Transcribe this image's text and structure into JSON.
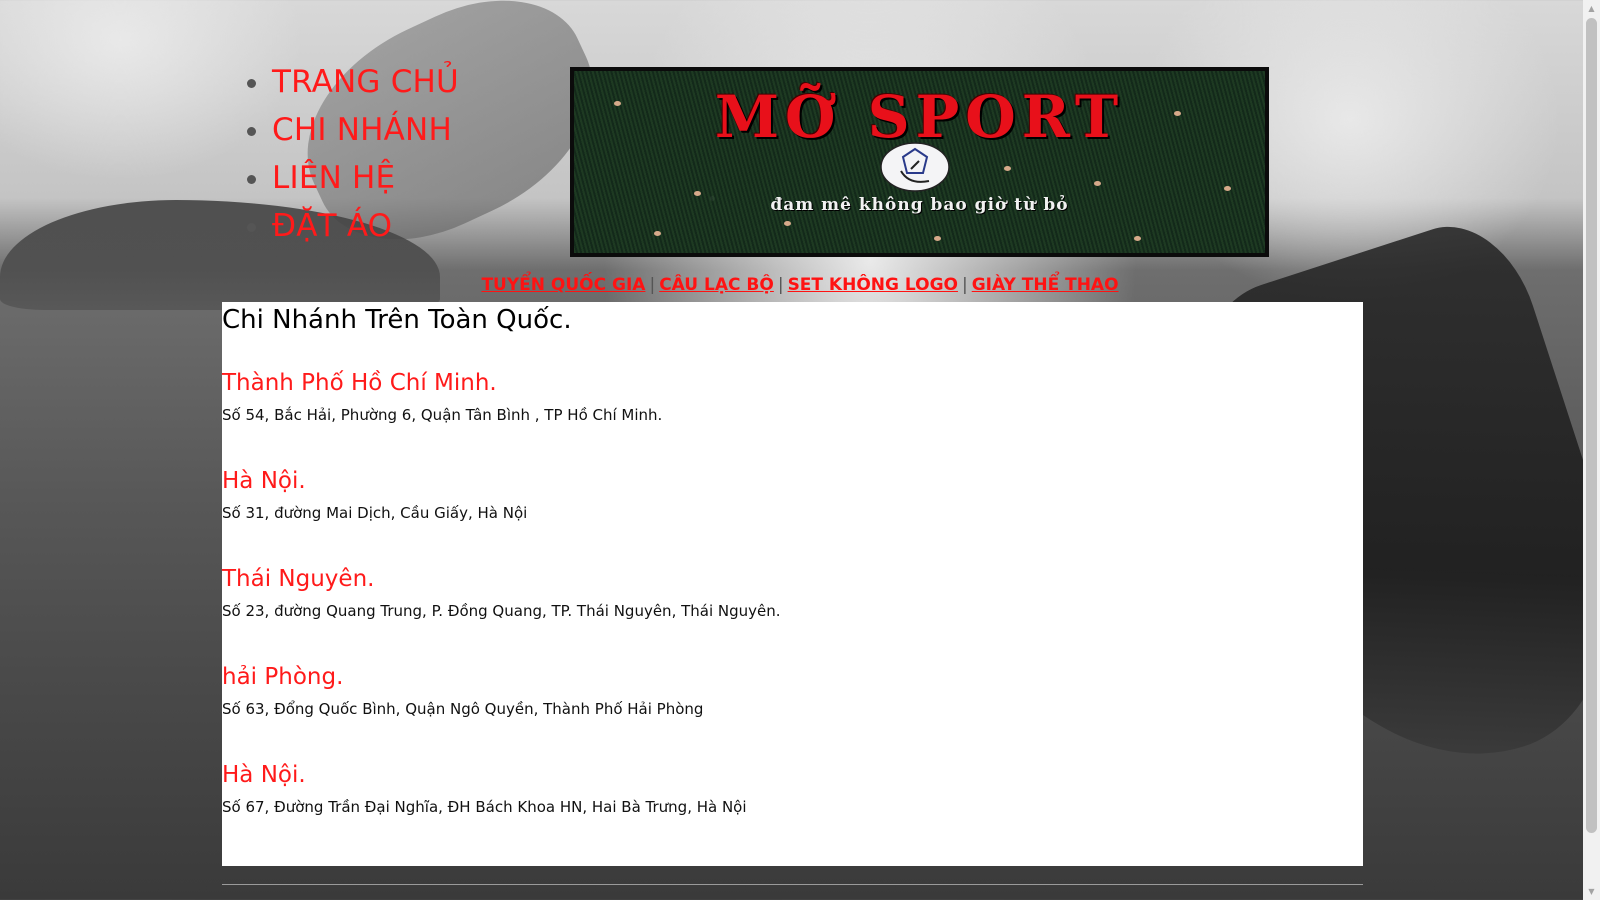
{
  "nav": {
    "items": [
      {
        "label": "TRANG CHỦ"
      },
      {
        "label": "CHI NHÁNH"
      },
      {
        "label": "LIÊN HỆ"
      },
      {
        "label": "ĐẶT ÁO"
      }
    ]
  },
  "logo": {
    "title": "MỠ SPORT",
    "tagline": "đam mê không bao giờ từ bỏ",
    "icon": "soccer-ball-icon"
  },
  "subnav": {
    "links": [
      {
        "label": "TUYỂN QUỐC GIA"
      },
      {
        "label": "CÂU LẠC BỘ"
      },
      {
        "label": "SET KHÔNG LOGO"
      },
      {
        "label": "GIÀY THỂ THAO"
      }
    ],
    "separator": "|"
  },
  "main": {
    "heading": "Chi Nhánh Trên Toàn Quốc.",
    "branches": [
      {
        "city": "Thành Phố Hồ Chí Minh.",
        "address": "Số 54, Bắc Hải, Phường 6, Quận Tân Bình , TP Hồ Chí Minh."
      },
      {
        "city": "Hà Nội.",
        "address": "Số 31, đường Mai Dịch, Cầu Giấy, Hà Nội"
      },
      {
        "city": "Thái Nguyên.",
        "address": "Số 23, đường Quang Trung, P. Đồng Quang, TP. Thái Nguyên, Thái Nguyên."
      },
      {
        "city": "hải Phòng.",
        "address": "Số 63, Đổng Quốc Bình, Quận Ngô Quyền, Thành Phố Hải Phòng"
      },
      {
        "city": "Hà Nội.",
        "address": "Số 67, Đường Trần Đại Nghĩa, ĐH Bách Khoa HN, Hai Bà Trưng, Hà Nội"
      }
    ]
  },
  "colors": {
    "accent": "#ff1a1a",
    "content_bg": "#ffffff",
    "logo_bg": "#17301c"
  }
}
